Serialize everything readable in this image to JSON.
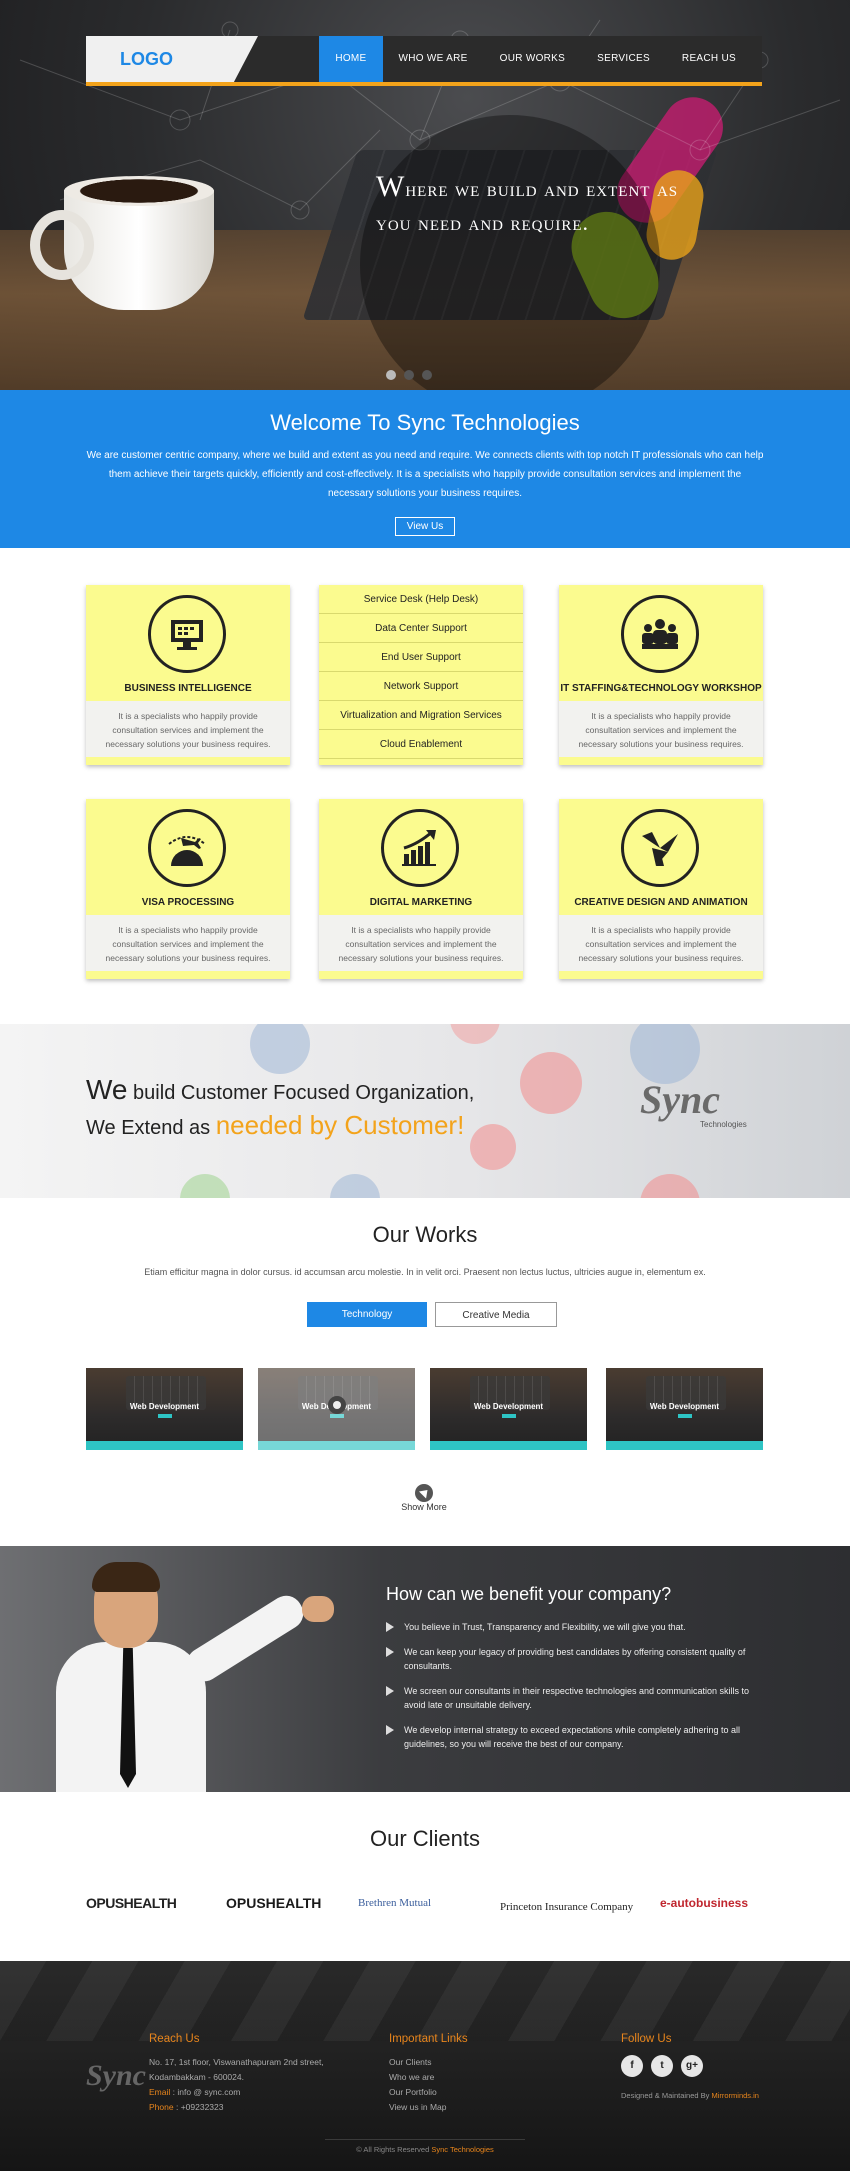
{
  "nav": {
    "logo": "LOGO",
    "items": [
      "HOME",
      "WHO WE ARE",
      "OUR WORKS",
      "SERVICES",
      "REACH US"
    ],
    "active": "HOME"
  },
  "hero": {
    "title_first": "W",
    "title_rest": "here we build and extent as",
    "title_line2": "you need and require."
  },
  "welcome": {
    "title": "Welcome To Sync Technologies",
    "text": "We are customer centric company, where we build and extent as you need and require. We connects clients with top notch IT professionals who can help them achieve their targets quickly, efficiently and cost-effectively. It is a specialists who happily provide consultation services and implement the necessary solutions your business requires.",
    "button": "View Us"
  },
  "services": {
    "card_desc": "It is a specialists who happily provide consultation services and implement the necessary solutions your business requires.",
    "cards": [
      {
        "title": "BUSINESS INTELLIGENCE",
        "icon": "monitor-icon"
      },
      {
        "title": "IT STAFFING&TECHNOLOGY WORKSHOP",
        "icon": "team-icon"
      },
      {
        "title": "VISA PROCESSING",
        "icon": "airplane-globe-icon"
      },
      {
        "title": "DIGITAL MARKETING",
        "icon": "growth-chart-icon"
      },
      {
        "title": "CREATIVE DESIGN AND ANIMATION",
        "icon": "origami-bird-icon"
      }
    ],
    "list": [
      "Service Desk (Help Desk)",
      "Data Center Support",
      "End User Support",
      "Network Support",
      "Virtualization and Migration Services",
      "Cloud Enablement"
    ]
  },
  "banner": {
    "line1_w": "We",
    "line1_rest": " build Customer Focused Organization,",
    "line2_start": "We Extend as ",
    "line2_highlight": "needed by Customer!",
    "logo": "Sync",
    "logo_sub": "Technologies"
  },
  "works": {
    "title": "Our Works",
    "subtitle": "Etiam efficitur magna in dolor cursus. id accumsan arcu molestie. In in velit orci. Praesent non lectus luctus, ultricies augue in, elementum ex.",
    "tabs": [
      "Technology",
      "Creative Media"
    ],
    "thumb_title": "Web Development",
    "show_more": "Show More"
  },
  "benefit": {
    "title": "How can we benefit your company?",
    "points": [
      "You believe in Trust, Transparency and Flexibility, we will give you that.",
      "We can keep your legacy of providing best candidates by offering consistent quality of consultants.",
      "We screen our consultants in their respective technologies and communication skills to avoid late or unsuitable delivery.",
      "We develop internal strategy to exceed expectations while completely adhering to all guidelines, so you will receive the best of our company."
    ]
  },
  "clients": {
    "title": "Our Clients",
    "logos": [
      "OPUSHEALTH",
      "OPUSHEALTH",
      "Brethren Mutual",
      "Princeton Insurance Company",
      "e-autobusiness"
    ]
  },
  "footer": {
    "reach_title": "Reach Us",
    "address1": "No. 17, 1st floor, Viswanathapuram 2nd street,",
    "address2": "Kodambakkam - 600024.",
    "email_label": "Email",
    "email": ": info @ sync.com",
    "phone_label": "Phone",
    "phone": ": +09232323",
    "links_title": "Important Links",
    "links": [
      "Our Clients",
      "Who we are",
      "Our Portfolio",
      "View us in Map"
    ],
    "follow_title": "Follow Us",
    "social": [
      "f",
      "t",
      "g+"
    ],
    "maintained_prefix": "Designed & Maintained By ",
    "maintained_by": "Mirrorminds.in",
    "copyright_prefix": "© All Rights Reserved ",
    "copyright_name": "Sync Technologies",
    "logo": "Sync"
  }
}
